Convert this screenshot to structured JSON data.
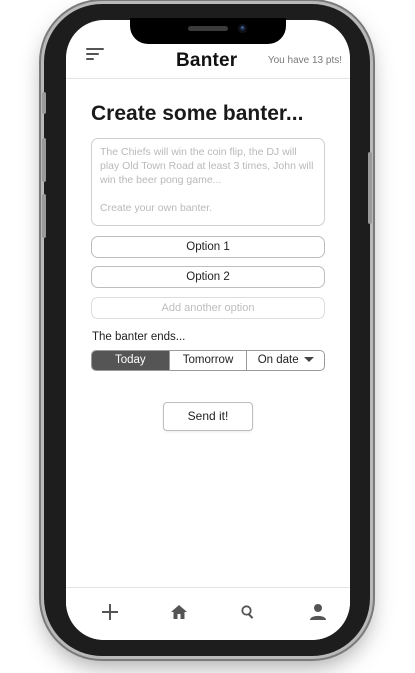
{
  "header": {
    "title": "Banter",
    "points_text": "You have 13 pts!",
    "menu_icon": "menu-icon"
  },
  "create": {
    "heading": "Create some banter...",
    "placeholder_line1": "The Chiefs will win the coin flip, the DJ will play Old Town Road at least 3 times, John will win the beer pong game...",
    "placeholder_line2": "Create your own banter."
  },
  "options": [
    {
      "label": "Option 1"
    },
    {
      "label": "Option 2"
    }
  ],
  "add_option_placeholder": "Add another option",
  "ends": {
    "label": "The banter ends...",
    "choices": [
      "Today",
      "Tomorrow",
      "On date"
    ],
    "selected": "Today"
  },
  "send_label": "Send it!",
  "tabbar": {
    "icons": [
      "plus-icon",
      "home-icon",
      "search-icon",
      "profile-icon"
    ]
  },
  "colors": {
    "accent_dark": "#555555",
    "border": "#bdbdbd",
    "placeholder": "#b9b9b9"
  }
}
